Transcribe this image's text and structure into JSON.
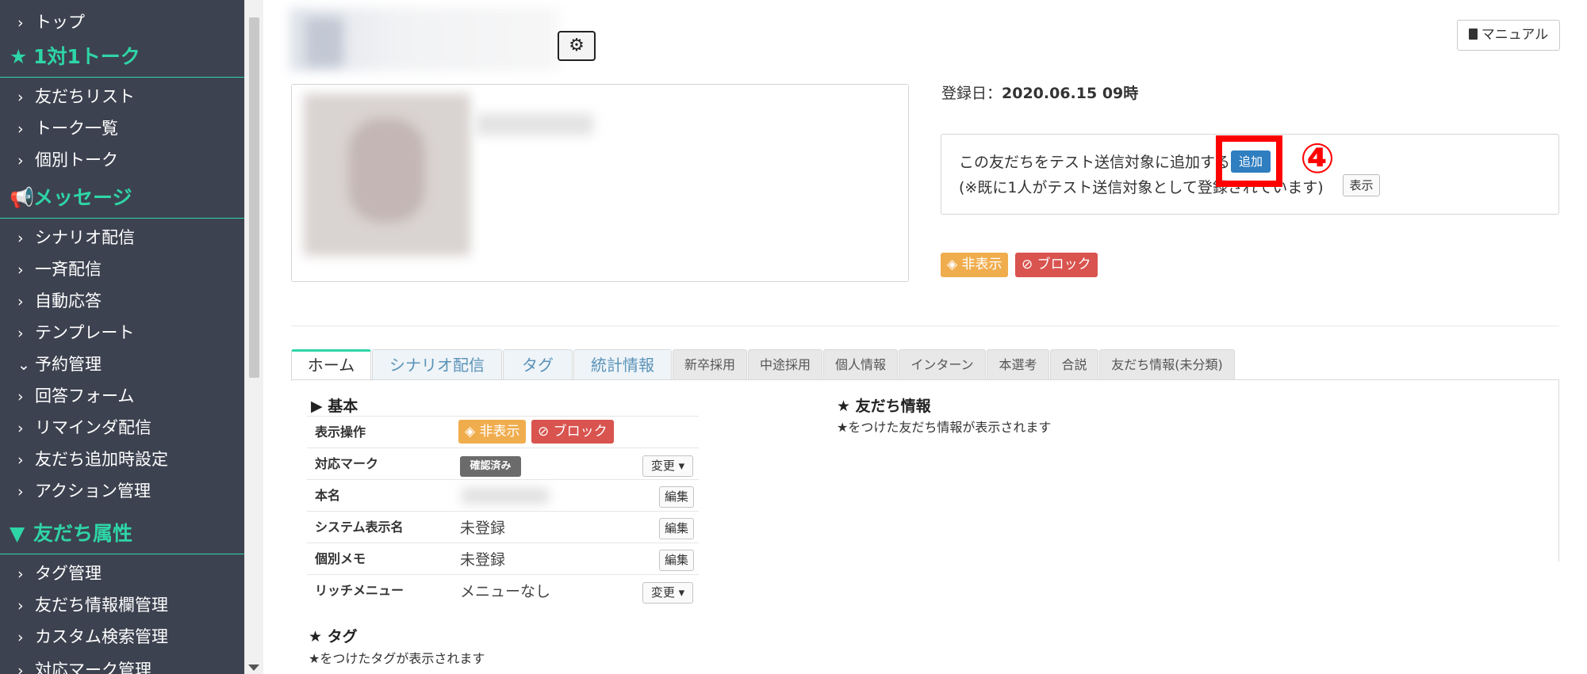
{
  "sidebar": {
    "items": [
      {
        "type": "item",
        "label": "トップ",
        "chevron": "›"
      },
      {
        "type": "head",
        "label": "1対1トーク",
        "icon": "★"
      },
      {
        "type": "item",
        "label": "友だちリスト",
        "chevron": "›"
      },
      {
        "type": "item",
        "label": "トーク一覧",
        "chevron": "›"
      },
      {
        "type": "item",
        "label": "個別トーク",
        "chevron": "›"
      },
      {
        "type": "head",
        "label": "メッセージ",
        "icon": "📢"
      },
      {
        "type": "item",
        "label": "シナリオ配信",
        "chevron": "›"
      },
      {
        "type": "item",
        "label": "一斉配信",
        "chevron": "›"
      },
      {
        "type": "item",
        "label": "自動応答",
        "chevron": "›"
      },
      {
        "type": "item",
        "label": "テンプレート",
        "chevron": "›"
      },
      {
        "type": "item",
        "label": "予約管理",
        "chevron": "⌄"
      },
      {
        "type": "item",
        "label": "回答フォーム",
        "chevron": "›"
      },
      {
        "type": "item",
        "label": "リマインダ配信",
        "chevron": "›"
      },
      {
        "type": "item",
        "label": "友だち追加時設定",
        "chevron": "›"
      },
      {
        "type": "item",
        "label": "アクション管理",
        "chevron": "›"
      },
      {
        "type": "head",
        "label": "友だち属性",
        "icon": "▼"
      },
      {
        "type": "item",
        "label": "タグ管理",
        "chevron": "›"
      },
      {
        "type": "item",
        "label": "友だち情報欄管理",
        "chevron": "›"
      },
      {
        "type": "item",
        "label": "カスタム検索管理",
        "chevron": "›"
      },
      {
        "type": "item",
        "label": "対応マーク管理",
        "chevron": "›"
      }
    ]
  },
  "header": {
    "manual_label": "マニュアル",
    "manual_icon": "book-icon",
    "gear_icon": "⚙"
  },
  "profile": {
    "registered_label": "登録日：",
    "registered_value": "2020.06.15 09時"
  },
  "test_send": {
    "line1": "この友だちをテスト送信対象に追加する",
    "add_label": "追加",
    "line2": "(※既に1人がテスト送信対象として登録されています)",
    "show_label": "表示",
    "annotation": "④"
  },
  "status": {
    "hidden_label": "非表示",
    "block_label": "ブロック"
  },
  "tabs": [
    {
      "label": "ホーム",
      "style": "active",
      "w": 101
    },
    {
      "label": "シナリオ配信",
      "style": "big",
      "w": 164
    },
    {
      "label": "タグ",
      "style": "big",
      "w": 88
    },
    {
      "label": "統計情報",
      "style": "big",
      "w": 124
    },
    {
      "label": "新卒採用",
      "style": "small",
      "w": 94
    },
    {
      "label": "中途採用",
      "style": "small",
      "w": 94
    },
    {
      "label": "個人情報",
      "style": "small",
      "w": 94
    },
    {
      "label": "インターン",
      "style": "small",
      "w": 110
    },
    {
      "label": "本選考",
      "style": "small",
      "w": 79
    },
    {
      "label": "合説",
      "style": "small",
      "w": 61
    },
    {
      "label": "友だち情報(未分類)",
      "style": "small",
      "w": 171
    }
  ],
  "basic": {
    "title": "▶ 基本",
    "rows": {
      "display_op": "表示操作",
      "mark": "対応マーク",
      "mark_badge": "確認済み",
      "real_name": "本名",
      "system_name": "システム表示名",
      "system_name_value": "未登録",
      "memo": "個別メモ",
      "memo_value": "未登録",
      "rich_menu": "リッチメニュー",
      "rich_menu_value": "メニューなし"
    },
    "change_label": "変更 ▾",
    "edit_label": "編集"
  },
  "friend_info": {
    "title": "★ 友だち情報",
    "note": "★をつけた友だち情報が表示されます"
  },
  "tag_section": {
    "title": "★ タグ",
    "note": "★をつけたタグが表示されます"
  },
  "colors": {
    "sidebar_bg": "#3d4250",
    "accent": "#2ed5a6",
    "orange": "#f0ad4e",
    "red": "#d9534f",
    "blue": "#2f7ec0"
  }
}
